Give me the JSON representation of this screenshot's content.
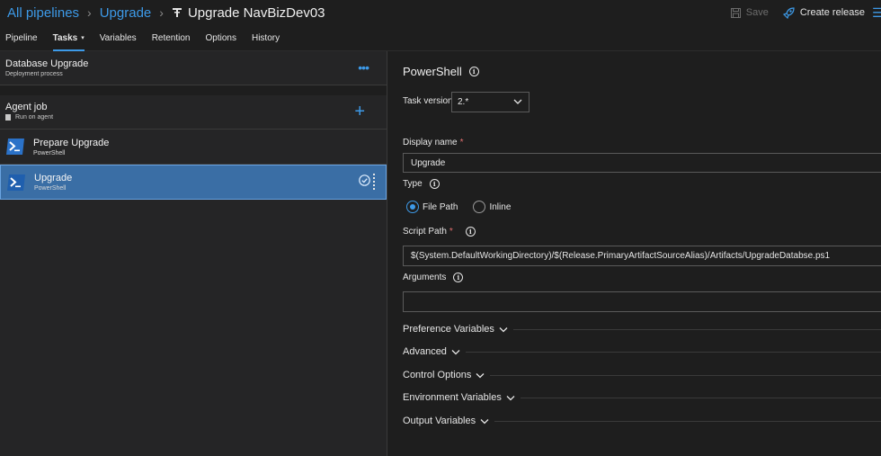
{
  "breadcrumb": {
    "all_pipelines": "All pipelines",
    "upgrade": "Upgrade",
    "release_title": "Upgrade NavBizDev03"
  },
  "toolbar": {
    "save_label": "Save",
    "create_release_label": "Create release"
  },
  "tabs": [
    {
      "label": "Pipeline"
    },
    {
      "label": "Tasks"
    },
    {
      "label": "Variables"
    },
    {
      "label": "Retention"
    },
    {
      "label": "Options"
    },
    {
      "label": "History"
    }
  ],
  "stage": {
    "title": "Database Upgrade",
    "subtitle": "Deployment process"
  },
  "agent_job": {
    "title": "Agent job",
    "subtitle": "Run on agent"
  },
  "tasks": [
    {
      "title": "Prepare Upgrade",
      "subtitle": "PowerShell"
    },
    {
      "title": "Upgrade",
      "subtitle": "PowerShell"
    }
  ],
  "details": {
    "section_title": "PowerShell",
    "task_version_label": "Task version",
    "task_version_value": "2.*",
    "display_name_label": "Display name",
    "display_name_value": "Upgrade",
    "type_label": "Type",
    "type_options": [
      "File Path",
      "Inline"
    ],
    "type_selected": "File Path",
    "script_path_label": "Script Path",
    "script_path_value": "$(System.DefaultWorkingDirectory)/$(Release.PrimaryArtifactSourceAlias)/Artifacts/UpgradeDatabse.ps1",
    "arguments_label": "Arguments",
    "arguments_value": "",
    "sections": [
      "Preference Variables",
      "Advanced",
      "Control Options",
      "Environment Variables",
      "Output Variables"
    ]
  },
  "colors": {
    "accent": "#3d9ae8",
    "selected_row": "#3a6ea5",
    "required": "#e36f6f"
  }
}
